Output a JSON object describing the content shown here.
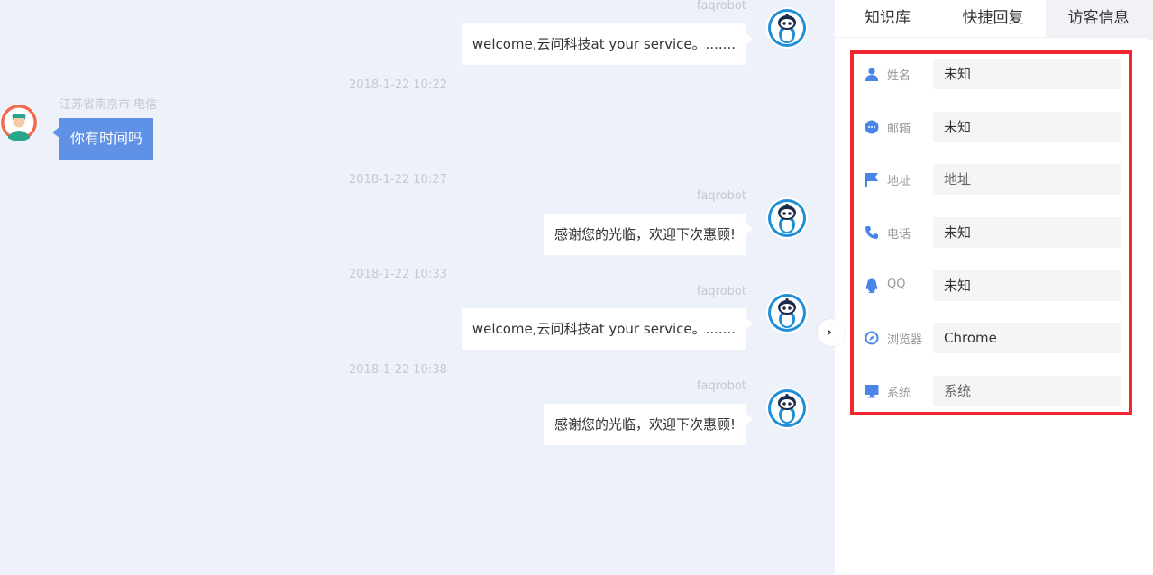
{
  "chat": {
    "robot_name": "faqrobot",
    "visitor_location": "江苏省南京市 电信",
    "messages": [
      {
        "text": "welcome,云问科技at your service。......."
      },
      {
        "time": "2018-1-22 10:22",
        "text": "你有时间吗"
      },
      {
        "time": "2018-1-22 10:27",
        "text": "感谢您的光临，欢迎下次惠顾!"
      },
      {
        "time": "2018-1-22 10:33",
        "text": "welcome,云问科技at your service。......."
      },
      {
        "time": "2018-1-22 10:38",
        "text": "感谢您的光临，欢迎下次惠顾!"
      }
    ]
  },
  "panel": {
    "tabs": [
      "知识库",
      "快捷回复",
      "访客信息"
    ],
    "active_tab": "访客信息",
    "fields": [
      {
        "label": "姓名",
        "value": "未知",
        "icon": "user-icon"
      },
      {
        "label": "邮箱",
        "value": "未知",
        "icon": "chat-bubble-icon"
      },
      {
        "label": "地址",
        "value": "地址",
        "icon": "flag-icon"
      },
      {
        "label": "电话",
        "value": "未知",
        "icon": "phone-icon"
      },
      {
        "label": "QQ",
        "value": "未知",
        "icon": "qq-penguin-icon"
      },
      {
        "label": "浏览器",
        "value": "Chrome",
        "icon": "compass-icon"
      },
      {
        "label": "系统",
        "value": "系统",
        "icon": "monitor-icon"
      }
    ]
  },
  "colors": {
    "background": "#edf2fa",
    "visitor_bubble": "#5f92e6",
    "highlight_border": "#f2262f",
    "icon_blue": "#4a86e8"
  }
}
